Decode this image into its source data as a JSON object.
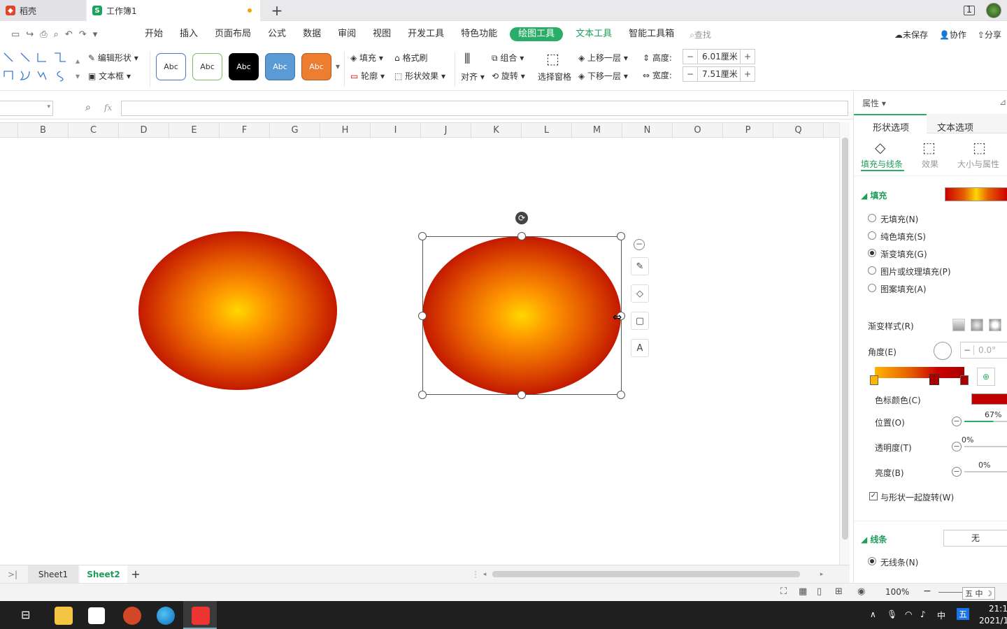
{
  "tabs": [
    {
      "label": "稻壳"
    },
    {
      "label": "工作簿1"
    }
  ],
  "menu": {
    "items": [
      "开始",
      "插入",
      "页面布局",
      "公式",
      "数据",
      "审阅",
      "视图",
      "开发工具",
      "特色功能"
    ],
    "active": "绘图工具",
    "text_tools": "文本工具",
    "smart": "智能工具箱",
    "search_placeholder": "查找",
    "unsaved": "未保存",
    "collab": "协作",
    "share": "分享"
  },
  "ribbon": {
    "edit_shape": "编辑形状",
    "text_box": "文本框",
    "style_label": "Abc",
    "fill": "填充",
    "format_brush": "格式刷",
    "outline": "轮廓",
    "shape_effect": "形状效果",
    "align": "对齐",
    "group": "组合",
    "rotate": "旋转",
    "select_pane": "选择窗格",
    "bring_forward": "上移一层",
    "send_backward": "下移一层",
    "height_label": "高度:",
    "height_value": "6.01厘米",
    "width_label": "宽度:",
    "width_value": "7.51厘米"
  },
  "formula": {
    "fx": "fx"
  },
  "columns": [
    "B",
    "C",
    "D",
    "E",
    "F",
    "G",
    "H",
    "I",
    "J",
    "K",
    "L",
    "M",
    "N",
    "O",
    "P",
    "Q"
  ],
  "sheets": {
    "tab1": "Sheet1",
    "tab2": "Sheet2"
  },
  "status": {
    "zoom": "100%"
  },
  "taskbar": {
    "time": "21:1",
    "date": "2021/1",
    "ime": "中"
  },
  "panel": {
    "title": "属性",
    "tab_shape": "形状选项",
    "tab_text": "文本选项",
    "sub_fill": "填充与线条",
    "sub_effect": "效果",
    "sub_size": "大小与属性",
    "fill_header": "填充",
    "fill_options": [
      "无填充(N)",
      "纯色填充(S)",
      "渐变填充(G)",
      "图片或纹理填充(P)",
      "图案填充(A)"
    ],
    "gradient_style": "渐变样式(R)",
    "angle_label": "角度(E)",
    "angle_value": "0.0°",
    "stop_color": "色标颜色(C)",
    "position_label": "位置(O)",
    "position_value": "67%",
    "transparency_label": "透明度(T)",
    "transparency_value": "0%",
    "brightness_label": "亮度(B)",
    "brightness_value": "0%",
    "rotate_with_shape": "与形状一起旋转(W)",
    "line_header": "线条",
    "line_value": "无",
    "no_line": "无线条(N)"
  },
  "colors": {
    "accent": "#2aae67",
    "ellipse_outer": "#a80000",
    "ellipse_center": "#ffd700"
  }
}
